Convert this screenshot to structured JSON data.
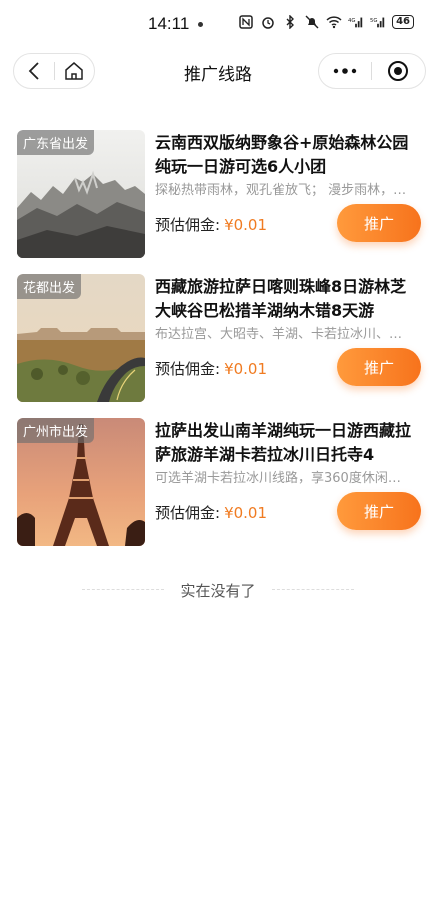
{
  "status_bar": {
    "time": "14:11",
    "battery": "46"
  },
  "nav": {
    "title": "推广线路"
  },
  "routes": [
    {
      "tag": "广东省出发",
      "title": "云南西双版纳野象谷+原始森林公园纯玩一日游可选6人小团",
      "desc": "探秘热带雨林，观孔雀放飞； 漫步雨林，…",
      "commission_label": "预估佣金:",
      "price": "¥0.01",
      "button": "推广"
    },
    {
      "tag": "花都出发",
      "title": "西藏旅游拉萨日喀则珠峰8日游林芝大峡谷巴松措羊湖纳木错8天游",
      "desc": "布达拉宫、大昭寺、羊湖、卡若拉冰川、…",
      "commission_label": "预估佣金:",
      "price": "¥0.01",
      "button": "推广"
    },
    {
      "tag": "广州市出发",
      "title": "拉萨出发山南羊湖纯玩一日游西藏拉萨旅游羊湖卡若拉冰川日托寺4",
      "desc": "可选羊湖卡若拉冰川线路，享360度休闲…",
      "commission_label": "预估佣金:",
      "price": "¥0.01",
      "button": "推广"
    }
  ],
  "end_text": "实在没有了",
  "colors": {
    "accent": "#f7731c",
    "price": "#f07b21"
  }
}
